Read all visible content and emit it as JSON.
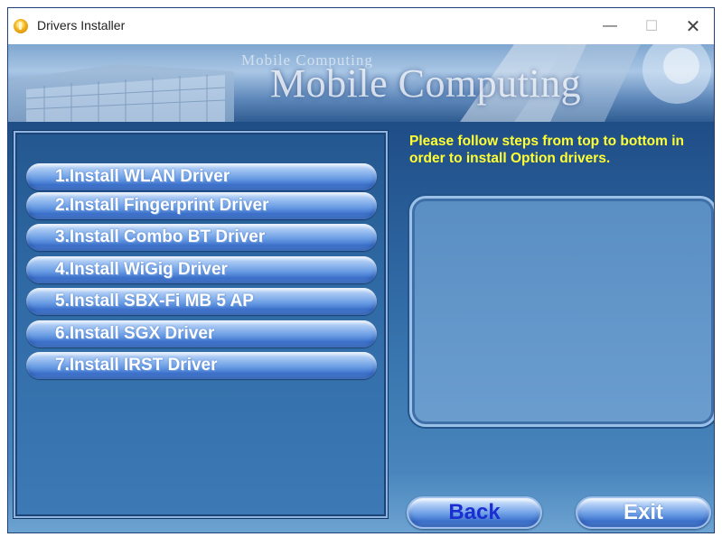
{
  "window": {
    "title": "Drivers Installer"
  },
  "titlebar": {
    "minimize": "—",
    "maximize": "☐",
    "close": "✕"
  },
  "banner": {
    "small_text": "Mobile Computing",
    "large_text": "Mobile Computing"
  },
  "drivers": [
    {
      "label": "1.Install WLAN Driver"
    },
    {
      "label": "2.Install Fingerprint Driver"
    },
    {
      "label": "3.Install Combo BT Driver"
    },
    {
      "label": "4.Install WiGig Driver"
    },
    {
      "label": "5.Install SBX-Fi MB 5 AP"
    },
    {
      "label": "6.Install SGX Driver"
    },
    {
      "label": "7.Install IRST Driver"
    }
  ],
  "instructions": "Please follow steps from top to bottom in order to install Option drivers.",
  "buttons": {
    "back": "Back",
    "exit": "Exit"
  },
  "colors": {
    "instruction_text": "#ffff33",
    "back_text": "#1b2fd1",
    "exit_text": "#ffffff"
  }
}
